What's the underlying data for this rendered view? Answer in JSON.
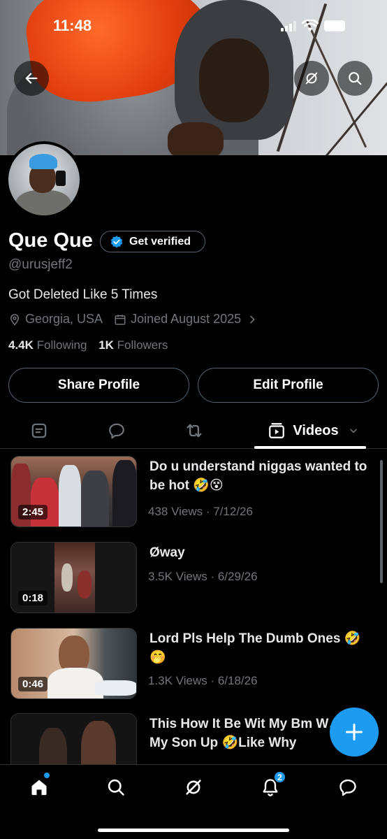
{
  "status_bar": {
    "time": "11:48"
  },
  "header": {
    "back_icon": "arrow-left-icon",
    "grok_icon": "grok-icon",
    "search_icon": "search-icon"
  },
  "profile": {
    "display_name": "Que Que",
    "get_verified_label": "Get verified",
    "handle": "@urusjeff2",
    "bio": "Got Deleted Like 5 Times",
    "location": "Georgia, USA",
    "joined": "Joined August 2025",
    "following_count": "4.4K",
    "following_label": "Following",
    "followers_count": "1K",
    "followers_label": "Followers"
  },
  "actions": {
    "share_label": "Share Profile",
    "edit_label": "Edit Profile"
  },
  "tabs": {
    "active_label": "Videos",
    "items": [
      "posts-icon",
      "replies-icon",
      "reposts-icon",
      "videos-icon"
    ]
  },
  "videos": [
    {
      "duration": "2:45",
      "title": "Do u understand niggas wanted to be hot 🤣😵",
      "meta": "438 Views · 7/12/26"
    },
    {
      "duration": "0:18",
      "title": "Øway",
      "meta": "3.5K Views · 6/29/26"
    },
    {
      "duration": "0:46",
      "title": "Lord Pls Help The Dumb Ones 🤣🤭",
      "meta": "1.3K Views · 6/18/26"
    },
    {
      "duration": "",
      "title": "This How It Be Wit My Bm W… Pick My Son Up 🤣Like Why",
      "meta": ""
    }
  ],
  "bottom_nav": {
    "items": [
      "home-icon",
      "search-icon",
      "grok-icon",
      "notifications-icon",
      "messages-icon"
    ],
    "notifications_badge": "2"
  },
  "colors": {
    "accent": "#1d9bf0",
    "background": "#000000",
    "secondary_text": "#71767b",
    "border": "#2f3336"
  }
}
